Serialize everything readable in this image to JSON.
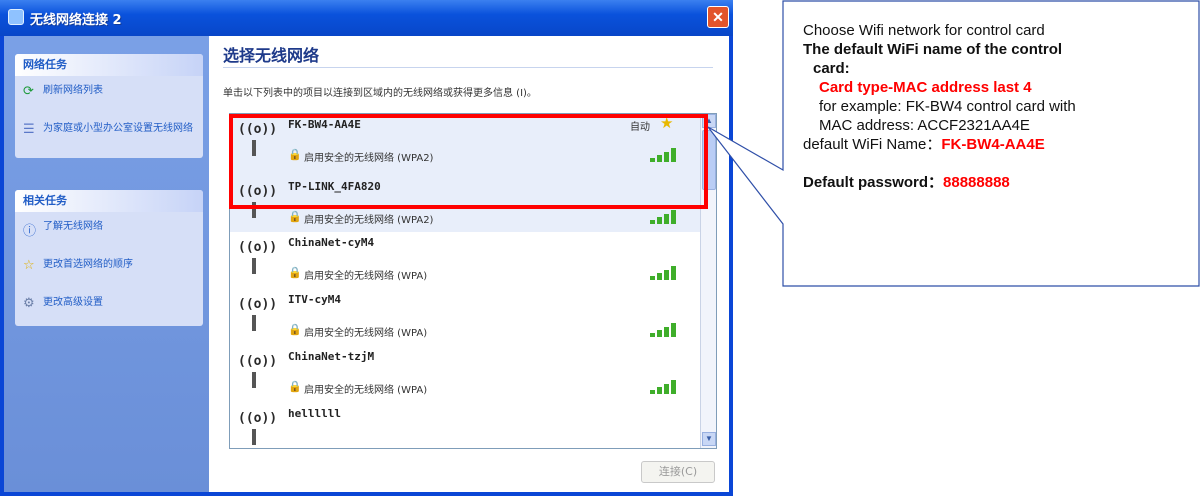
{
  "window": {
    "title": "无线网络连接 2",
    "close_label": "✕"
  },
  "left_pane": {
    "network_tasks_title": "网络任务",
    "network_tasks": [
      {
        "icon": "refresh-icon",
        "label": "刷新网络列表"
      },
      {
        "icon": "setup-icon",
        "label": "为家庭或小型办公室设置无线网络"
      }
    ],
    "related_tasks_title": "相关任务",
    "related_tasks": [
      {
        "icon": "info-icon",
        "label": "了解无线网络"
      },
      {
        "icon": "star-icon",
        "label": "更改首选网络的顺序"
      },
      {
        "icon": "settings-icon",
        "label": "更改高级设置"
      }
    ]
  },
  "right_pane": {
    "title": "选择无线网络",
    "description": "单击以下列表中的项目以连接到区域内的无线网络或获得更多信息 (I)。",
    "networks": [
      {
        "name": "FK-BW4-AA4E",
        "security": "启用安全的无线网络 (WPA2)",
        "auto": "自动",
        "starred": true,
        "selected": true
      },
      {
        "name": "TP-LINK_4FA820",
        "security": "启用安全的无线网络 (WPA2)",
        "auto": "",
        "starred": false,
        "selected": true
      },
      {
        "name": "ChinaNet-cyM4",
        "security": "启用安全的无线网络 (WPA)",
        "auto": "",
        "starred": false,
        "selected": false
      },
      {
        "name": "ITV-cyM4",
        "security": "启用安全的无线网络 (WPA)",
        "auto": "",
        "starred": false,
        "selected": false
      },
      {
        "name": "ChinaNet-tzjM",
        "security": "启用安全的无线网络 (WPA)",
        "auto": "",
        "starred": false,
        "selected": false
      },
      {
        "name": "hellllll",
        "security": "",
        "auto": "",
        "starred": false,
        "selected": false
      }
    ],
    "connect_label": "连接(C)"
  },
  "annotation": {
    "line1": "Choose Wifi network for control card",
    "line2": "The default WiFi name of the control",
    "line3": "card:",
    "line4": "Card type-MAC address last 4",
    "line5": "for example: FK-BW4 control card with",
    "line6": "MAC address: ACCF2321AA4E",
    "line7_prefix": "default WiFi Name：",
    "line7_value": "FK-BW4-AA4E",
    "line8_prefix": "Default password：",
    "line8_value": "88888888"
  },
  "colors": {
    "title_bar": "#0a52dc",
    "highlight_box": "#ff0000",
    "annotation_red": "#ff0000",
    "annotation_border": "#2f4fa8"
  }
}
